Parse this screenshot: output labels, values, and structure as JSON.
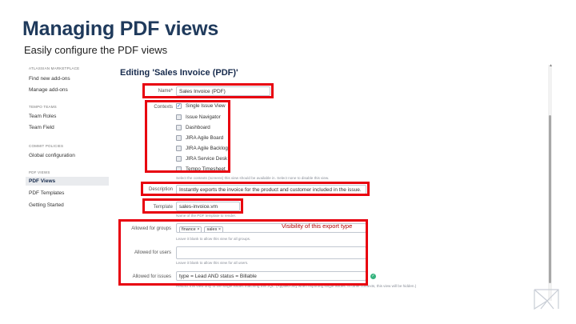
{
  "slide": {
    "title": "Managing PDF views",
    "subtitle": "Easily configure the PDF views"
  },
  "sidebar": {
    "sections": [
      {
        "header": "ATLASSIAN MARKETPLACE",
        "items": [
          "Find new add-ons",
          "Manage add-ons"
        ]
      },
      {
        "header": "TEMPO TEAMS",
        "items": [
          "Team Roles",
          "Team Field"
        ]
      },
      {
        "header": "COMMIT POLICIES",
        "items": [
          "Global configuration"
        ]
      },
      {
        "header": "PDF VIEWS",
        "items": [
          "PDF Views",
          "PDF Templates",
          "Getting Started"
        ]
      }
    ],
    "active_item": "PDF Views"
  },
  "main": {
    "heading": "Editing 'Sales Invoice (PDF)'",
    "name": {
      "label": "Name*",
      "value": "Sales Invoice (PDF)"
    },
    "contexts": {
      "label": "Contexts",
      "options": [
        {
          "label": "Single Issue View",
          "checked": true
        },
        {
          "label": "Issue Navigator",
          "checked": false
        },
        {
          "label": "Dashboard",
          "checked": false
        },
        {
          "label": "JIRA Agile Board",
          "checked": false
        },
        {
          "label": "JIRA Agile Backlog",
          "checked": false
        },
        {
          "label": "JIRA Service Desk",
          "checked": false
        },
        {
          "label": "Tempo Timesheet",
          "checked": false
        }
      ],
      "help": "Select the contexts (screens) this view should be available in. Select none to disable this view."
    },
    "description": {
      "label": "Description",
      "value": "Instantly exports the invoice for the product and customer included in the issue."
    },
    "template": {
      "label": "Template",
      "value": "sales-invoice.vm",
      "help": "Name of the PDF template to render."
    },
    "allowed_groups": {
      "label": "Allowed for groups",
      "tags": [
        "finance ×",
        "sales ×"
      ],
      "help": "Leave it blank to allow this view for all groups."
    },
    "allowed_users": {
      "label": "Allowed for users",
      "value": "",
      "help": "Leave it blank to allow this view for all users."
    },
    "allowed_issues": {
      "label": "Allowed for issues",
      "value": "type = Lead AND status = Billable",
      "help": "Restrict this view only to the single issues matching this JQL. (Applied only when exporting single issues. In other contexts, this view will be hidden.)"
    }
  },
  "annotation": {
    "visibility": "Visibility of this export type"
  },
  "colors": {
    "title": "#1f3a5c",
    "highlight": "#e8000f",
    "valid": "#36b37e"
  }
}
